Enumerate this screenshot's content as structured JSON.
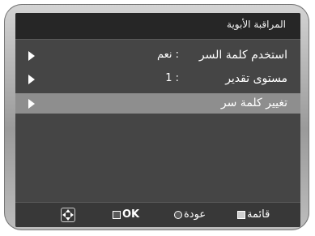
{
  "title": "المراقبة الأبوية",
  "menu": {
    "items": [
      {
        "label": "استخدم كلمة السر",
        "value": ": نعم",
        "selected": false
      },
      {
        "label": "مستوى تقدير",
        "value": ": 1",
        "selected": false
      },
      {
        "label": "تغيير كلمة سر",
        "value": "",
        "selected": true
      }
    ]
  },
  "footer": {
    "ok_label": "OK",
    "back_label": "عودة",
    "menu_label": "قائمة",
    "nav_icon": "directional-pad-icon",
    "ok_icon": "ok-square-icon",
    "back_icon": "return-icon",
    "menu_icon": "menu-icon"
  },
  "colors": {
    "screen_bg": "#454545",
    "titlebar_bg": "#262626",
    "selected_row_bg": "#8e8e8e",
    "text": "#ffffff"
  }
}
